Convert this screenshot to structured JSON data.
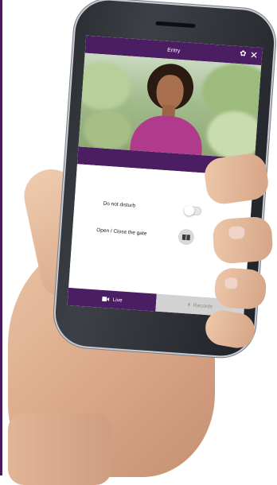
{
  "app": {
    "title": "Entry",
    "icons": {
      "settings": "gear-icon",
      "close": "close-icon"
    }
  },
  "settings": {
    "do_not_disturb_label": "Do not disturb",
    "do_not_disturb_on": false,
    "gate_label": "Open / Close the gate"
  },
  "tabs": {
    "live_label": "Live",
    "records_label": "Records",
    "active": "Live"
  },
  "colors": {
    "brand_purple": "#4b1d63",
    "inactive_tab": "#d2d2d2"
  }
}
